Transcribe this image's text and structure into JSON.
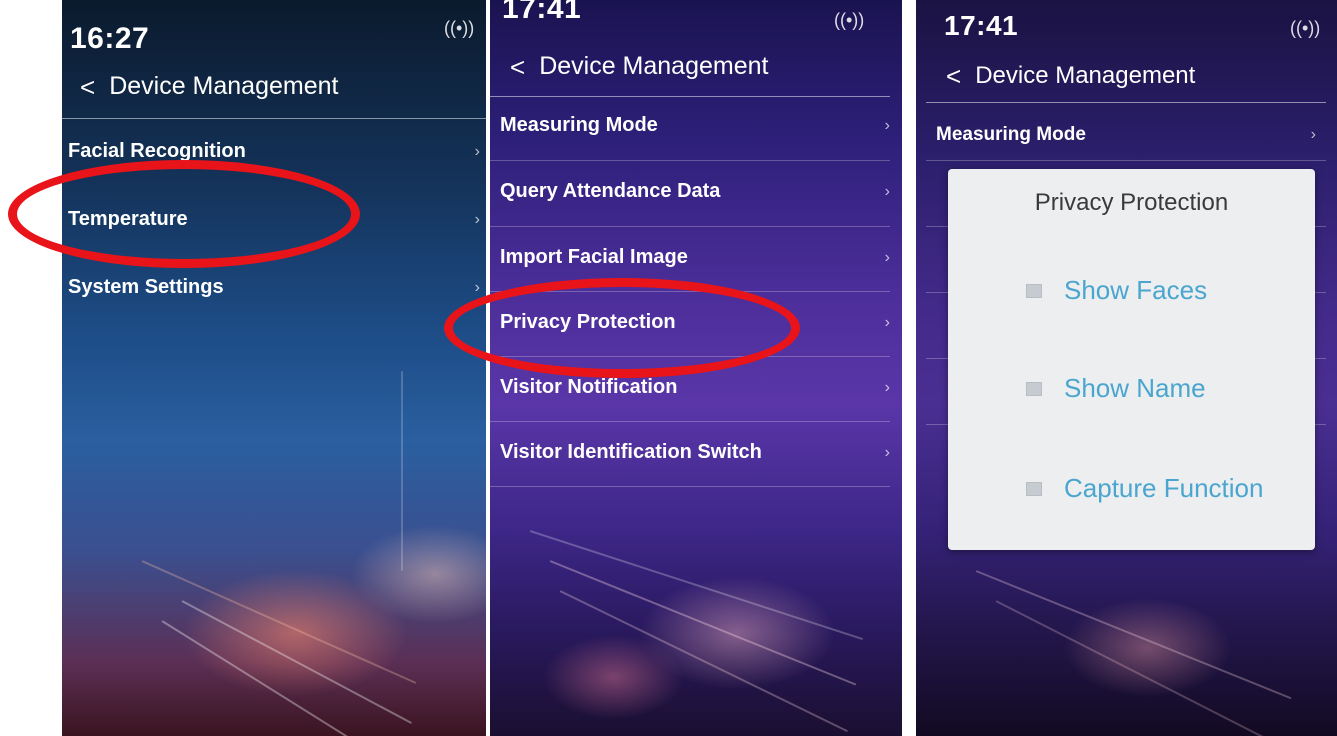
{
  "screen1": {
    "time": "16:27",
    "signal_icon": "wireless-signal-icon",
    "back_icon": "back-chevron-icon",
    "title": "Device Management",
    "menu": [
      {
        "label": "Facial Recognition"
      },
      {
        "label": "Temperature"
      },
      {
        "label": "System Settings"
      }
    ]
  },
  "screen2": {
    "time": "17:41",
    "signal_icon": "wireless-signal-icon",
    "back_icon": "back-chevron-icon",
    "title": "Device Management",
    "menu": [
      {
        "label": "Measuring Mode"
      },
      {
        "label": "Query Attendance Data"
      },
      {
        "label": "Import Facial Image"
      },
      {
        "label": "Privacy Protection"
      },
      {
        "label": "Visitor Notification"
      },
      {
        "label": "Visitor Identification Switch"
      }
    ]
  },
  "screen3": {
    "time": "17:41",
    "signal_icon": "wireless-signal-icon",
    "back_icon": "back-chevron-icon",
    "title": "Device Management",
    "menu": [
      {
        "label": "Measuring Mode"
      }
    ],
    "popup": {
      "title": "Privacy Protection",
      "options": [
        {
          "label": "Show Faces"
        },
        {
          "label": "Show Name"
        },
        {
          "label": "Capture Function"
        }
      ]
    }
  },
  "colors": {
    "highlight_circle": "#e8141a",
    "popup_option_text": "#4aa5cf",
    "popup_background": "#eceef0"
  }
}
